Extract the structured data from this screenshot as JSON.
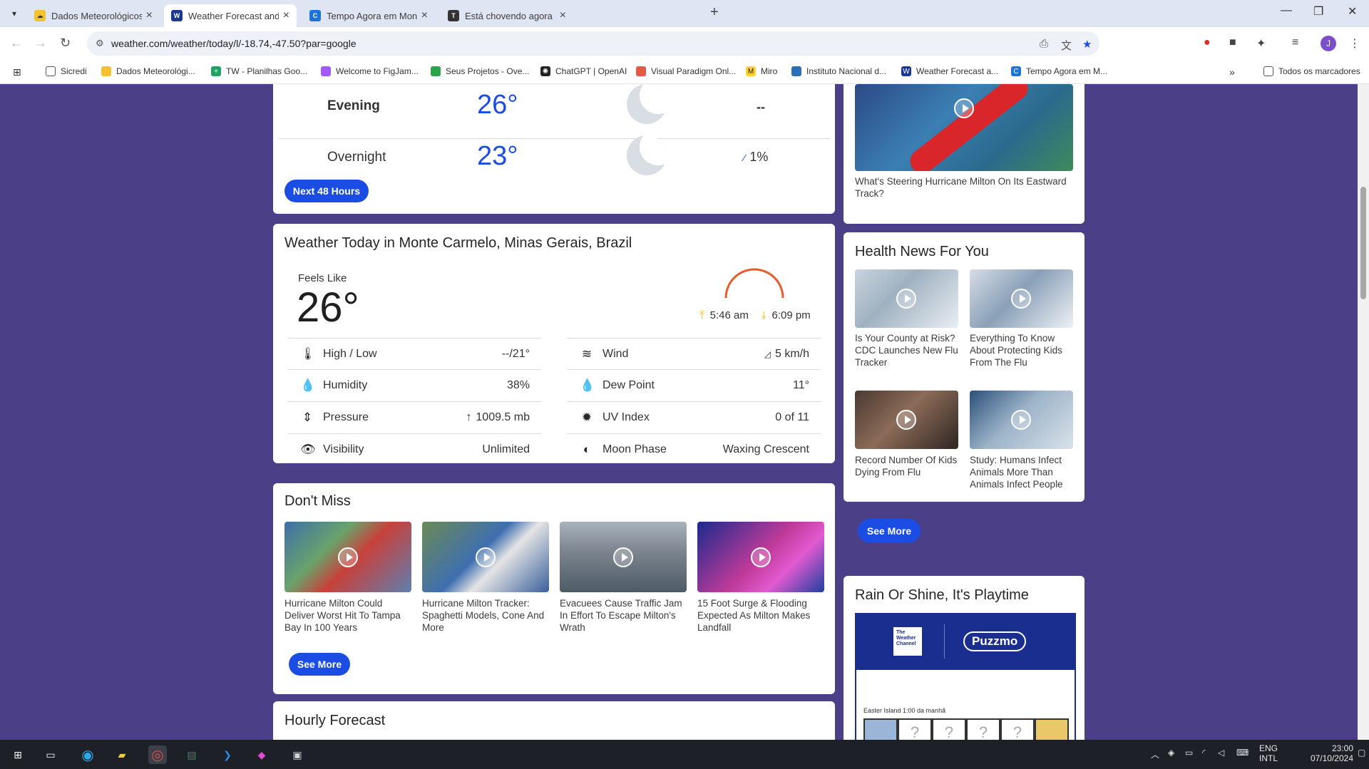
{
  "browser": {
    "tabs": [
      {
        "title": "Dados Meteorológicos",
        "favicon": "sun-cloud-icon",
        "active": false
      },
      {
        "title": "Weather Forecast and Conditio",
        "favicon": "weather-channel-icon",
        "active": true
      },
      {
        "title": "Tempo Agora em Monte Carme",
        "favicon": "climatempo-icon",
        "active": false
      },
      {
        "title": "Está chovendo agora em Monte",
        "favicon": "tempo-icon",
        "active": false
      }
    ],
    "url": "weather.com/weather/today/l/-18.74,-47.50?par=google",
    "bookmarks": [
      "Sicredi",
      "Dados Meteorológi...",
      "TW - Planilhas Goo...",
      "Welcome to FigJam...",
      "Seus Projetos - Ove...",
      "ChatGPT | OpenAI",
      "Visual Paradigm Onl...",
      "Miro",
      "Instituto Nacional d...",
      "Weather Forecast a...",
      "Tempo Agora em M..."
    ],
    "all_bookmarks": "Todos os marcadores"
  },
  "daypart": {
    "rows": [
      {
        "label": "Evening",
        "temp": "26°",
        "precip": "--"
      },
      {
        "label": "Overnight",
        "temp": "23°",
        "precip": "1%"
      }
    ],
    "next_button": "Next 48 Hours"
  },
  "today": {
    "title": "Weather Today in Monte Carmelo, Minas Gerais, Brazil",
    "feels_like_label": "Feels Like",
    "feels_like": "26°",
    "sunrise": "5:46 am",
    "sunset": "6:09 pm",
    "details": [
      {
        "icon": "thermometer-icon",
        "label": "High / Low",
        "value": "--/21°"
      },
      {
        "icon": "wind-icon",
        "label": "Wind",
        "value": "5 km/h"
      },
      {
        "icon": "humidity-drop-icon",
        "label": "Humidity",
        "value": "38%"
      },
      {
        "icon": "dew-point-icon",
        "label": "Dew Point",
        "value": "11°"
      },
      {
        "icon": "pressure-icon",
        "label": "Pressure",
        "value": "1009.5 mb"
      },
      {
        "icon": "uv-index-icon",
        "label": "UV Index",
        "value": "0 of 11"
      },
      {
        "icon": "visibility-eye-icon",
        "label": "Visibility",
        "value": "Unlimited"
      },
      {
        "icon": "moon-phase-icon",
        "label": "Moon Phase",
        "value": "Waxing Crescent"
      }
    ]
  },
  "dont_miss": {
    "title": "Don't Miss",
    "items": [
      "Hurricane Milton Could Deliver Worst Hit To Tampa Bay In 100 Years",
      "Hurricane Milton Tracker: Spaghetti Models, Cone And More",
      "Evacuees Cause Traffic Jam In Effort To Escape Milton's Wrath",
      "15 Foot Surge & Flooding Expected As Milton Makes Landfall"
    ],
    "see_more": "See More"
  },
  "hourly": {
    "title": "Hourly Forecast"
  },
  "sidebar": {
    "video_caption": "What's Steering Hurricane Milton On Its Eastward Track?",
    "health": {
      "title": "Health News For You",
      "items": [
        "Is Your County at Risk? CDC Launches New Flu Tracker",
        "Everything To Know About Protecting Kids From The Flu",
        "Record Number Of Kids Dying From Flu",
        "Study: Humans Infect Animals More Than Animals Infect People"
      ],
      "see_more": "See More"
    },
    "playtime": {
      "title": "Rain Or Shine, It's Playtime",
      "brand_left": "The Weather Channel",
      "brand_right": "Puzzmo",
      "game_caption": "Easter Island 1:00 da manhã",
      "tiles": [
        "?",
        "?",
        "?",
        "?",
        "?",
        "?"
      ]
    }
  },
  "taskbar": {
    "lang": "ENG",
    "layout": "INTL",
    "time": "23:00",
    "date": "07/10/2024"
  },
  "colors": {
    "page_bg": "#4b3f87",
    "accent": "#1b4de4",
    "sunrise": "#f5b301",
    "sun_arc": "#e85c2b"
  }
}
